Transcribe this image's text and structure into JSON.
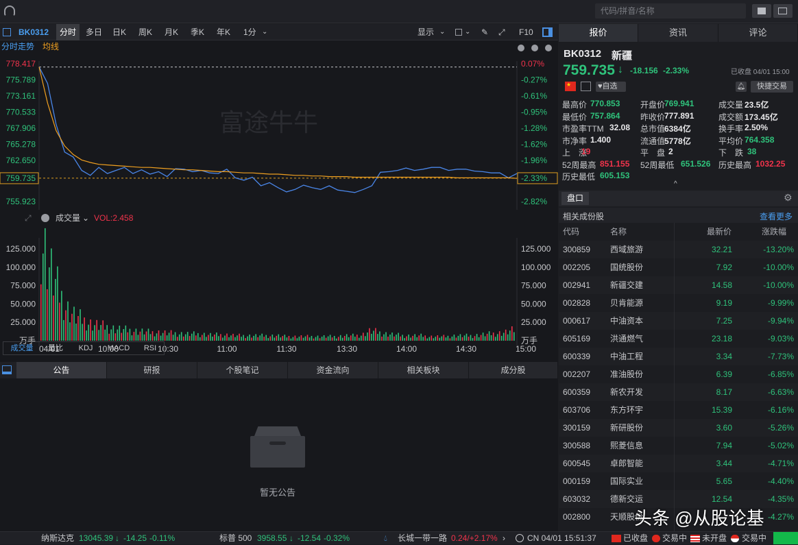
{
  "topbar": {
    "search_placeholder": "代码/拼音/名称"
  },
  "toolbar": {
    "code": "BK0312",
    "tabs": [
      "分时",
      "多日",
      "日K",
      "周K",
      "月K",
      "季K",
      "年K",
      "1分"
    ],
    "display": "显示",
    "f10": "F10"
  },
  "chart": {
    "tab_intraday": "分时走势",
    "tab_avg": "均线",
    "watermark": "富途牛牛",
    "price_labels": [
      "778.417",
      "775.789",
      "773.161",
      "770.533",
      "767.906",
      "765.278",
      "762.650",
      "759.735",
      "755.923"
    ],
    "pct_labels": [
      "0.07%",
      "-0.27%",
      "-0.61%",
      "-0.95%",
      "-1.28%",
      "-1.62%",
      "-1.96%",
      "-2.33%",
      "-2.82%"
    ],
    "vol_title": "成交量",
    "vol_value": "VOL:2.458",
    "vol_labels": [
      "125.000",
      "100.000",
      "75.000",
      "50.000",
      "25.000",
      "万手"
    ],
    "time_labels": [
      "04/01",
      "10:00",
      "10:30",
      "11:00",
      "11:30",
      "13:30",
      "14:00",
      "14:30",
      "15:00"
    ],
    "indicators": [
      "成交量",
      "量比",
      "KDJ",
      "MACD",
      "RSI"
    ]
  },
  "chart_data": {
    "type": "line",
    "title": "",
    "x_range": [
      "09:30",
      "15:00"
    ],
    "ylim": [
      755.923,
      778.417
    ],
    "prev_close": 777.891,
    "price_series": [
      777.9,
      775.2,
      768.5,
      764.0,
      763.2,
      761.0,
      760.2,
      761.5,
      760.5,
      761.0,
      761.5,
      760.5,
      761.1,
      760.4,
      760.8,
      760.0,
      761.3,
      761.2,
      760.8,
      761.0,
      760.6,
      760.5,
      761.2,
      759.8,
      759.4,
      759.9,
      758.5,
      759.0,
      758.2,
      757.5,
      757.9,
      758.6,
      758.2,
      757.9,
      758.5,
      757.8,
      757.6,
      757.4,
      757.9,
      758.5,
      760.7,
      760.8,
      761.0,
      761.4,
      761.0,
      761.2,
      761.5,
      761.5,
      761.0,
      761.2,
      761.2,
      760.9,
      760.8,
      760.6,
      760.6,
      759.8,
      760.5
    ],
    "avg_series": [
      777.9,
      772.0,
      767.5,
      765.0,
      763.6,
      762.7,
      762.3,
      762.0,
      761.9,
      761.8,
      761.7,
      761.6,
      761.5,
      761.5,
      761.4,
      761.3,
      761.2,
      761.1,
      761.1,
      761.0,
      760.9,
      760.8,
      760.8,
      760.7,
      760.6,
      760.6,
      760.5,
      760.4,
      760.4,
      760.3,
      760.2,
      760.2,
      760.1,
      760.1,
      760.0,
      760.0,
      760.0,
      759.9,
      759.9,
      759.9,
      759.9,
      759.9,
      759.9,
      759.9,
      759.9,
      759.9,
      759.9,
      759.9,
      759.9,
      759.8,
      759.8,
      759.8,
      759.8,
      759.8,
      759.8,
      759.8,
      759.7
    ],
    "volume_wanshou": [
      128,
      90,
      62,
      40,
      30,
      25,
      20,
      18,
      16,
      14,
      13,
      12,
      11,
      10,
      10,
      9,
      9,
      8,
      8,
      8,
      7,
      7,
      7,
      6,
      6,
      6,
      6,
      6,
      6,
      5,
      5,
      5,
      5,
      5,
      5,
      5,
      6,
      6,
      7,
      12,
      10,
      8,
      7,
      6,
      6,
      6,
      5,
      5,
      5,
      6,
      6,
      6,
      7,
      8,
      9,
      10,
      13
    ]
  },
  "bottom_tabs": [
    "公告",
    "研报",
    "个股笔记",
    "资金流向",
    "相关板块",
    "成分股"
  ],
  "empty_text": "暂无公告",
  "right": {
    "tabs": [
      "报价",
      "资讯",
      "评论"
    ],
    "code": "BK0312",
    "name": "新疆",
    "price": "759.735",
    "arrow": "↓",
    "change": "-18.156",
    "change_pct": "-2.33%",
    "status": "已收盘 04/01 15:00",
    "watch": "自选",
    "trade": "快捷交易",
    "stats": [
      [
        "最高价",
        "770.853",
        "开盘价",
        "769.941",
        "成交量",
        "23.5亿"
      ],
      [
        "最低价",
        "757.864",
        "昨收价",
        "777.891",
        "成交额",
        "173.45亿"
      ],
      [
        "市盈率TTM",
        "32.08",
        "总市值",
        "6384亿",
        "换手率",
        "2.50%"
      ],
      [
        "市净率",
        "1.400",
        "流通值",
        "5778亿",
        "平均价",
        "764.358"
      ],
      [
        "上　涨",
        "19",
        "平　盘",
        "2",
        "下　跌",
        "38"
      ],
      [
        "52周最高",
        "851.155",
        "52周最低",
        "651.526",
        "历史最高",
        "1032.25"
      ],
      [
        "历史最低",
        "605.153",
        "",
        "",
        "",
        ""
      ]
    ],
    "panel_title": "盘口",
    "constituents_title": "相关成份股",
    "more": "查看更多",
    "cols": [
      "代码",
      "名称",
      "最新价",
      "涨跌幅"
    ],
    "stocks": [
      [
        "300859",
        "西域旅游",
        "32.21",
        "-13.20%"
      ],
      [
        "002205",
        "国统股份",
        "7.92",
        "-10.00%"
      ],
      [
        "002941",
        "新疆交建",
        "14.58",
        "-10.00%"
      ],
      [
        "002828",
        "贝肯能源",
        "9.19",
        "-9.99%"
      ],
      [
        "000617",
        "中油资本",
        "7.25",
        "-9.94%"
      ],
      [
        "605169",
        "洪通燃气",
        "23.18",
        "-9.03%"
      ],
      [
        "600339",
        "中油工程",
        "3.34",
        "-7.73%"
      ],
      [
        "002207",
        "准油股份",
        "6.39",
        "-6.85%"
      ],
      [
        "600359",
        "新农开发",
        "8.17",
        "-6.63%"
      ],
      [
        "603706",
        "东方环宇",
        "15.39",
        "-6.16%"
      ],
      [
        "300159",
        "新研股份",
        "3.60",
        "-5.26%"
      ],
      [
        "300588",
        "熙菱信息",
        "7.94",
        "-5.02%"
      ],
      [
        "600545",
        "卓郎智能",
        "3.44",
        "-4.71%"
      ],
      [
        "000159",
        "国际实业",
        "5.65",
        "-4.40%"
      ],
      [
        "603032",
        "德新交运",
        "12.54",
        "-4.35%"
      ],
      [
        "002800",
        "天顺股份",
        "",
        "-4.27%"
      ]
    ]
  },
  "bottombar": {
    "nasdaq_name": "纳斯达克",
    "nasdaq_val": "13045.39",
    "nasdaq_chg": "-14.25",
    "nasdaq_pct": "-0.11%",
    "sp_name": "标普 500",
    "sp_val": "3958.55",
    "sp_chg": "-12.54",
    "sp_pct": "-0.32%",
    "fund_name": "长城一带一路",
    "fund_val": "0.24/+2.17%",
    "clock": "CN 04/01 15:51:37",
    "m1": "已收盘",
    "m2": "交易中",
    "m3": "未开盘",
    "m4": "交易中",
    "watermark": "头条 @从股论基"
  }
}
